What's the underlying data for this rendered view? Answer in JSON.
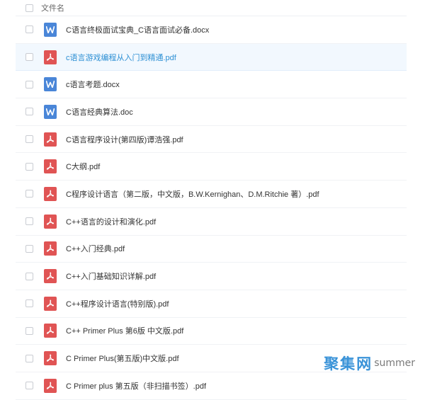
{
  "header": {
    "column_label": "文件名"
  },
  "files": [
    {
      "name": "C语言终极面试宝典_C语言面试必备.docx",
      "type": "word",
      "icon": "word-doc-icon",
      "selected": false
    },
    {
      "name": "c语言游戏编程从入门到精通.pdf",
      "type": "pdf",
      "icon": "pdf-file-icon",
      "selected": true
    },
    {
      "name": "c语言考题.docx",
      "type": "word",
      "icon": "word-doc-icon",
      "selected": false
    },
    {
      "name": "C语言经典算法.doc",
      "type": "word",
      "icon": "word-doc-icon",
      "selected": false
    },
    {
      "name": "C语言程序设计(第四版)谭浩强.pdf",
      "type": "pdf",
      "icon": "pdf-file-icon",
      "selected": false
    },
    {
      "name": "C大纲.pdf",
      "type": "pdf",
      "icon": "pdf-file-icon",
      "selected": false
    },
    {
      "name": "C程序设计语言（第二版，中文版，B.W.Kernighan、D.M.Ritchie 著）.pdf",
      "type": "pdf",
      "icon": "pdf-file-icon",
      "selected": false
    },
    {
      "name": "C++语言的设计和演化.pdf",
      "type": "pdf",
      "icon": "pdf-file-icon",
      "selected": false
    },
    {
      "name": "C++入门经典.pdf",
      "type": "pdf",
      "icon": "pdf-file-icon",
      "selected": false
    },
    {
      "name": "C++入门基础知识详解.pdf",
      "type": "pdf",
      "icon": "pdf-file-icon",
      "selected": false
    },
    {
      "name": "C++程序设计语言(特别版).pdf",
      "type": "pdf",
      "icon": "pdf-file-icon",
      "selected": false
    },
    {
      "name": "C++ Primer Plus 第6版 中文版.pdf",
      "type": "pdf",
      "icon": "pdf-file-icon",
      "selected": false
    },
    {
      "name": "C Primer Plus(第五版)中文版.pdf",
      "type": "pdf",
      "icon": "pdf-file-icon",
      "selected": false
    },
    {
      "name": "C Primer plus 第五版（非扫描书签）.pdf",
      "type": "pdf",
      "icon": "pdf-file-icon",
      "selected": false
    }
  ],
  "watermark": {
    "cn": "聚集网",
    "en": "summer"
  },
  "colors": {
    "selected_text": "#2c8fd4",
    "selected_bg": "#f2f8fe",
    "word_icon": "#4a86d8",
    "pdf_icon": "#e05454"
  }
}
